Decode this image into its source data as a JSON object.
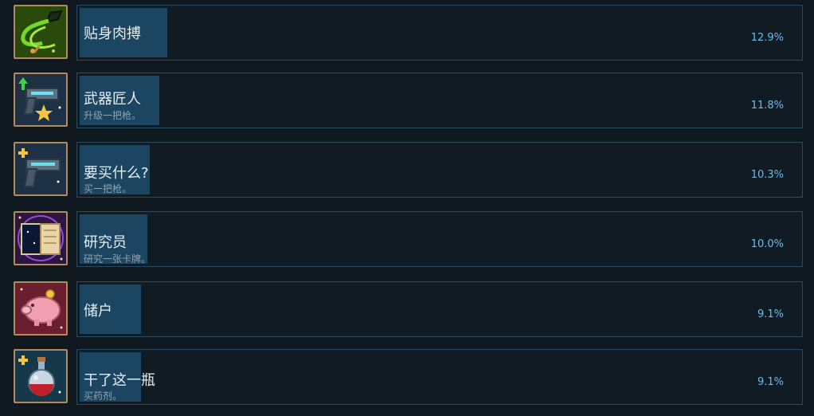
{
  "achievements": [
    {
      "title": "贴身肉搏",
      "description": "",
      "percent": "12.9%",
      "percent_value": 12.9,
      "icon": "whip-icon",
      "icon_bg": "#2a4a0c"
    },
    {
      "title": "武器匠人",
      "description": "升级一把枪。",
      "percent": "11.8%",
      "percent_value": 11.8,
      "icon": "upgrade-gun-icon",
      "icon_bg": "#1d3044"
    },
    {
      "title": "要买什么?",
      "description": "买一把枪。",
      "percent": "10.3%",
      "percent_value": 10.3,
      "icon": "buy-gun-icon",
      "icon_bg": "#1d3044"
    },
    {
      "title": "研究员",
      "description": "研究一张卡牌。",
      "percent": "10.0%",
      "percent_value": 10.0,
      "icon": "book-icon",
      "icon_bg": "#2a1640"
    },
    {
      "title": "储户",
      "description": "",
      "percent": "9.1%",
      "percent_value": 9.1,
      "icon": "piggy-bank-icon",
      "icon_bg": "#6a1e30"
    },
    {
      "title": "干了这一瓶",
      "description": "买药剂。",
      "percent": "9.1%",
      "percent_value": 9.1,
      "icon": "potion-icon",
      "icon_bg": "#15384a"
    }
  ],
  "colors": {
    "background": "#101820",
    "card_border": "#2a4a5e",
    "progress_fill": "#1b4560",
    "percent_text": "#66bdf0",
    "icon_border": "#b48a5a"
  }
}
